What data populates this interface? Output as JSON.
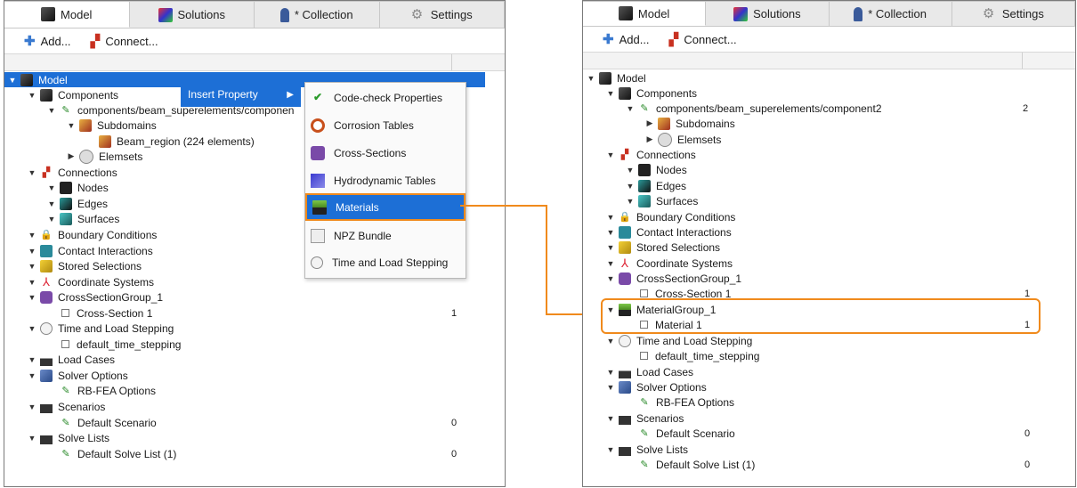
{
  "tabs": [
    {
      "label": "Model",
      "icon": "model-cube-icon",
      "active": true
    },
    {
      "label": "Solutions",
      "icon": "solutions-icon",
      "active": false
    },
    {
      "label": "* Collection",
      "icon": "collection-icon",
      "active": false
    },
    {
      "label": "Settings",
      "icon": "gear-icon",
      "active": false
    }
  ],
  "toolbar": {
    "add_label": "Add...",
    "connect_label": "Connect..."
  },
  "left_tree": {
    "model": "Model",
    "components": "Components",
    "component_path": "components/beam_superelements/componen",
    "subdomains": "Subdomains",
    "beam_region": "Beam_region (224 elements)",
    "elemsets": "Elemsets",
    "connections": "Connections",
    "nodes": "Nodes",
    "edges": "Edges",
    "surfaces": "Surfaces",
    "boundary": "Boundary Conditions",
    "contact": "Contact Interactions",
    "stored": "Stored Selections",
    "coord": "Coordinate Systems",
    "cross_group": "CrossSectionGroup_1",
    "cross_section": "Cross-Section 1",
    "cross_count": "1",
    "time_load": "Time and Load Stepping",
    "default_time": "default_time_stepping",
    "load_cases": "Load Cases",
    "solver": "Solver Options",
    "rbfea": "RB-FEA Options",
    "scenarios": "Scenarios",
    "default_scenario": "Default Scenario",
    "scenario_count": "0",
    "solve_lists": "Solve Lists",
    "default_solve": "Default Solve List (1)",
    "solve_count": "0"
  },
  "context_menu": {
    "insert_property": "Insert Property",
    "items": [
      "Code-check Properties",
      "Corrosion Tables",
      "Cross-Sections",
      "Hydrodynamic Tables",
      "Materials",
      "NPZ Bundle",
      "Time and Load Stepping"
    ]
  },
  "right_tree": {
    "model": "Model",
    "components": "Components",
    "component_path": "components/beam_superelements/component2",
    "component_count": "2",
    "subdomains": "Subdomains",
    "elemsets": "Elemsets",
    "connections": "Connections",
    "nodes": "Nodes",
    "edges": "Edges",
    "surfaces": "Surfaces",
    "boundary": "Boundary Conditions",
    "contact": "Contact Interactions",
    "stored": "Stored Selections",
    "coord": "Coordinate Systems",
    "cross_group": "CrossSectionGroup_1",
    "cross_section": "Cross-Section 1",
    "cross_count": "1",
    "material_group": "MaterialGroup_1",
    "material": "Material 1",
    "material_count": "1",
    "time_load": "Time and Load Stepping",
    "default_time": "default_time_stepping",
    "load_cases": "Load Cases",
    "solver": "Solver Options",
    "rbfea": "RB-FEA Options",
    "scenarios": "Scenarios",
    "default_scenario": "Default Scenario",
    "scenario_count": "0",
    "solve_lists": "Solve Lists",
    "default_solve": "Default Solve List (1)",
    "solve_count": "0"
  },
  "colors": {
    "selection": "#1d6fd6",
    "highlight": "#f08a1c"
  }
}
